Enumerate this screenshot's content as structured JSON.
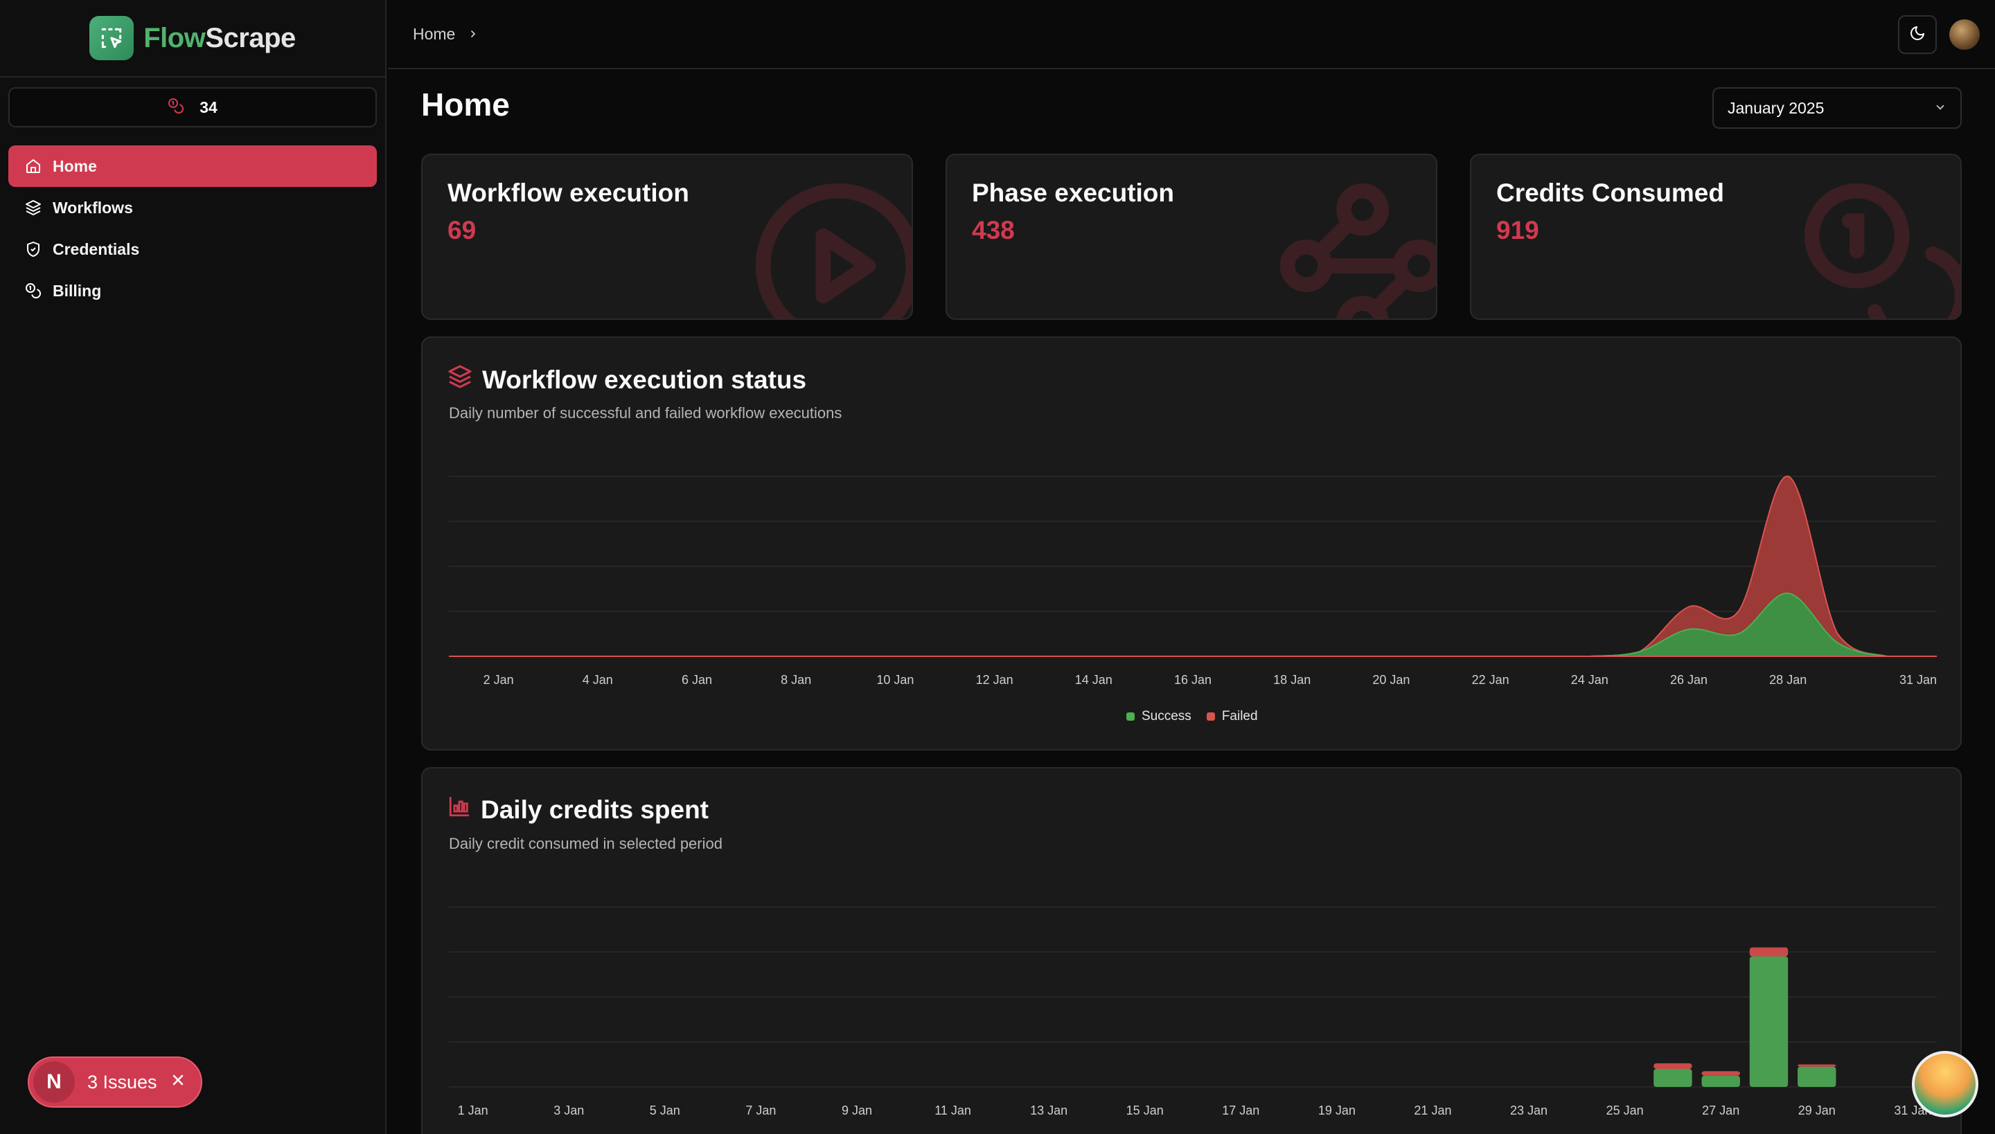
{
  "app": {
    "name_part1": "Flow",
    "name_part2": "Scrape"
  },
  "sidebar": {
    "credits": "34",
    "items": [
      {
        "label": "Home",
        "icon": "home-icon",
        "active": true
      },
      {
        "label": "Workflows",
        "icon": "layers-icon",
        "active": false
      },
      {
        "label": "Credentials",
        "icon": "shield-icon",
        "active": false
      },
      {
        "label": "Billing",
        "icon": "coins-icon",
        "active": false
      }
    ]
  },
  "topbar": {
    "breadcrumb": "Home"
  },
  "main": {
    "title": "Home",
    "period": "January 2025",
    "stats": [
      {
        "title": "Workflow execution",
        "value": "69",
        "icon": "play-circle-icon"
      },
      {
        "title": "Phase execution",
        "value": "438",
        "icon": "waypoints-icon"
      },
      {
        "title": "Credits Consumed",
        "value": "919",
        "icon": "coins-icon"
      }
    ],
    "status_panel": {
      "title": "Workflow execution status",
      "subtitle": "Daily number of successful and failed workflow executions",
      "legend": [
        "Success",
        "Failed"
      ]
    },
    "credits_panel": {
      "title": "Daily credits spent",
      "subtitle": "Daily credit consumed in selected period"
    }
  },
  "issues": {
    "letter": "N",
    "label": "3 Issues"
  },
  "colors": {
    "accent": "#d03a50",
    "success": "#4caf50",
    "failed": "#d9534f"
  },
  "chart_data": [
    {
      "type": "area",
      "title": "Workflow execution status",
      "x_ticks": [
        "2 Jan",
        "4 Jan",
        "6 Jan",
        "8 Jan",
        "10 Jan",
        "12 Jan",
        "14 Jan",
        "16 Jan",
        "18 Jan",
        "20 Jan",
        "22 Jan",
        "24 Jan",
        "26 Jan",
        "28 Jan",
        "31 Jan"
      ],
      "x": [
        "1 Jan",
        "2 Jan",
        "3 Jan",
        "4 Jan",
        "5 Jan",
        "6 Jan",
        "7 Jan",
        "8 Jan",
        "9 Jan",
        "10 Jan",
        "11 Jan",
        "12 Jan",
        "13 Jan",
        "14 Jan",
        "15 Jan",
        "16 Jan",
        "17 Jan",
        "18 Jan",
        "19 Jan",
        "20 Jan",
        "21 Jan",
        "22 Jan",
        "23 Jan",
        "24 Jan",
        "25 Jan",
        "26 Jan",
        "27 Jan",
        "28 Jan",
        "29 Jan",
        "30 Jan",
        "31 Jan"
      ],
      "stacked": true,
      "series": [
        {
          "name": "Success",
          "values": [
            0,
            0,
            0,
            0,
            0,
            0,
            0,
            0,
            0,
            0,
            0,
            0,
            0,
            0,
            0,
            0,
            0,
            0,
            0,
            0,
            0,
            0,
            0,
            0,
            1,
            6,
            5,
            14,
            3,
            0,
            0
          ]
        },
        {
          "name": "Failed",
          "values": [
            0,
            0,
            0,
            0,
            0,
            0,
            0,
            0,
            0,
            0,
            0,
            0,
            0,
            0,
            0,
            0,
            0,
            0,
            0,
            0,
            0,
            0,
            0,
            0,
            0,
            5,
            5,
            26,
            2,
            0,
            0
          ]
        }
      ],
      "ylim": [
        0,
        40
      ]
    },
    {
      "type": "bar",
      "title": "Daily credits spent",
      "x_ticks": [
        "1 Jan",
        "3 Jan",
        "5 Jan",
        "7 Jan",
        "9 Jan",
        "11 Jan",
        "13 Jan",
        "15 Jan",
        "17 Jan",
        "19 Jan",
        "21 Jan",
        "23 Jan",
        "25 Jan",
        "27 Jan",
        "29 Jan",
        "31 Jan"
      ],
      "x": [
        "1 Jan",
        "2 Jan",
        "3 Jan",
        "4 Jan",
        "5 Jan",
        "6 Jan",
        "7 Jan",
        "8 Jan",
        "9 Jan",
        "10 Jan",
        "11 Jan",
        "12 Jan",
        "13 Jan",
        "14 Jan",
        "15 Jan",
        "16 Jan",
        "17 Jan",
        "18 Jan",
        "19 Jan",
        "20 Jan",
        "21 Jan",
        "22 Jan",
        "23 Jan",
        "24 Jan",
        "25 Jan",
        "26 Jan",
        "27 Jan",
        "28 Jan",
        "29 Jan",
        "30 Jan",
        "31 Jan"
      ],
      "stacked": true,
      "series": [
        {
          "name": "Success",
          "values": [
            0,
            0,
            0,
            0,
            0,
            0,
            0,
            0,
            0,
            0,
            0,
            0,
            0,
            0,
            0,
            0,
            0,
            0,
            0,
            0,
            0,
            0,
            0,
            0,
            0,
            80,
            50,
            580,
            90,
            0,
            0
          ]
        },
        {
          "name": "Failed",
          "values": [
            0,
            0,
            0,
            0,
            0,
            0,
            0,
            0,
            0,
            0,
            0,
            0,
            0,
            0,
            0,
            0,
            0,
            0,
            0,
            0,
            0,
            0,
            0,
            0,
            0,
            25,
            20,
            40,
            10,
            0,
            0
          ]
        }
      ],
      "ylim": [
        0,
        800
      ]
    }
  ]
}
